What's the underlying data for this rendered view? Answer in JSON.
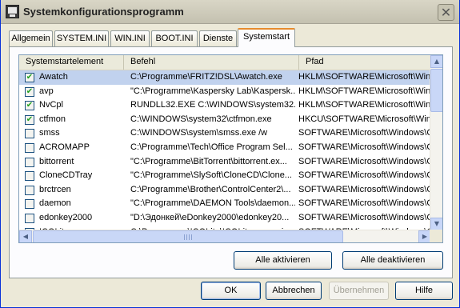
{
  "window": {
    "title": "Systemkonfigurationsprogramm",
    "close_label": "✕"
  },
  "tabs": [
    {
      "label": "Allgemein",
      "active": false
    },
    {
      "label": "SYSTEM.INI",
      "active": false
    },
    {
      "label": "WIN.INI",
      "active": false
    },
    {
      "label": "BOOT.INI",
      "active": false
    },
    {
      "label": "Dienste",
      "active": false
    },
    {
      "label": "Systemstart",
      "active": true
    }
  ],
  "table": {
    "columns": [
      "Systemstartelement",
      "Befehl",
      "Pfad"
    ],
    "rows": [
      {
        "checked": true,
        "name": "Awatch",
        "command": "C:\\Programme\\FRITZ!DSL\\Awatch.exe",
        "path": "HKLM\\SOFTWARE\\Microsoft\\Win"
      },
      {
        "checked": true,
        "name": "avp",
        "command": "\"C:\\Programme\\Kaspersky Lab\\Kaspersk...",
        "path": "HKLM\\SOFTWARE\\Microsoft\\Win"
      },
      {
        "checked": true,
        "name": "NvCpl",
        "command": "RUNDLL32.EXE C:\\WINDOWS\\system32...",
        "path": "HKLM\\SOFTWARE\\Microsoft\\Win"
      },
      {
        "checked": true,
        "name": "ctfmon",
        "command": "C:\\WINDOWS\\system32\\ctfmon.exe",
        "path": "HKCU\\SOFTWARE\\Microsoft\\Win"
      },
      {
        "checked": false,
        "name": "smss",
        "command": "C:\\WINDOWS\\system\\smss.exe /w",
        "path": "SOFTWARE\\Microsoft\\Windows\\C"
      },
      {
        "checked": false,
        "name": "ACROMAPP",
        "command": "C:\\Programme\\Tech\\Office Program Sel...",
        "path": "SOFTWARE\\Microsoft\\Windows\\C"
      },
      {
        "checked": false,
        "name": "bittorrent",
        "command": "\"C:\\Programme\\BitTorrent\\bittorrent.ex...",
        "path": "SOFTWARE\\Microsoft\\Windows\\C"
      },
      {
        "checked": false,
        "name": "CloneCDTray",
        "command": "\"C:\\Programme\\SlySoft\\CloneCD\\Clone...",
        "path": "SOFTWARE\\Microsoft\\Windows\\C"
      },
      {
        "checked": false,
        "name": "brctrcen",
        "command": "C:\\Programme\\Brother\\ControlCenter2\\...",
        "path": "SOFTWARE\\Microsoft\\Windows\\C"
      },
      {
        "checked": false,
        "name": "daemon",
        "command": "\"C:\\Programme\\DAEMON Tools\\daemon....",
        "path": "SOFTWARE\\Microsoft\\Windows\\C"
      },
      {
        "checked": false,
        "name": "edonkey2000",
        "command": "\"D:\\Эдонкей\\eDonkey2000\\edonkey20...",
        "path": "SOFTWARE\\Microsoft\\Windows\\C"
      },
      {
        "checked": false,
        "name": "ICOLite",
        "command": "C:\\Programme\\ICOLite\\ICOLite.exe -mi...",
        "path": "SOFTWARE\\Microsoft\\Windows\\C"
      }
    ]
  },
  "actions": {
    "enable_all": "Alle aktivieren",
    "disable_all": "Alle deaktivieren"
  },
  "footer": {
    "ok": "OK",
    "cancel": "Abbrechen",
    "apply": "Übernehmen",
    "help": "Hilfe"
  },
  "checkmark": "✔"
}
